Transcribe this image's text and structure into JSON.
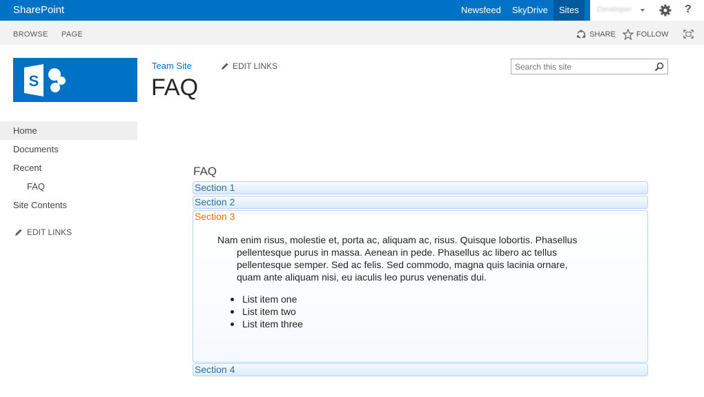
{
  "suite": {
    "brand": "SharePoint",
    "links": [
      "Newsfeed",
      "SkyDrive",
      "Sites"
    ],
    "user": "Developer"
  },
  "ribbon": {
    "tabs": [
      "BROWSE",
      "PAGE"
    ],
    "share": "SHARE",
    "follow": "FOLLOW"
  },
  "header": {
    "breadcrumb": "Team Site",
    "edit_links": "EDIT LINKS",
    "title": "FAQ",
    "search_placeholder": "Search this site"
  },
  "nav": {
    "items": [
      {
        "label": "Home"
      },
      {
        "label": "Documents"
      },
      {
        "label": "Recent"
      },
      {
        "label": "FAQ"
      },
      {
        "label": "Site Contents"
      }
    ],
    "edit_links": "EDIT LINKS"
  },
  "content": {
    "heading": "FAQ",
    "sections": [
      "Section 1",
      "Section 2",
      "Section 3",
      "Section 4"
    ],
    "paragraph": "Nam enim risus, molestie et, porta ac, aliquam ac, risus. Quisque lobortis. Phasellus pellentesque purus in massa. Aenean in pede. Phasellus ac libero ac tellus pellentesque semper. Sed ac felis. Sed commodo, magna quis lacinia ornare, quam ante aliquam nisi, eu iaculis leo purus venenatis dui.",
    "list": [
      "List item one",
      "List item two",
      "List item three"
    ]
  },
  "colors": {
    "suite_blue": "#0072c6",
    "accordion_text": "#2e6e9e",
    "active_section": "#e07020"
  }
}
